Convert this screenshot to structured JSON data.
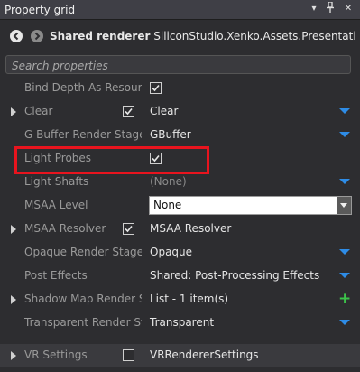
{
  "window": {
    "title": "Property grid",
    "controls": [
      "▾",
      "ᵖ",
      "✕"
    ]
  },
  "header": {
    "object_name": "Shared renderer",
    "object_type": "SiliconStudio.Xenko.Assets.Presentation.Ass..."
  },
  "search": {
    "placeholder": "Search properties",
    "value": ""
  },
  "properties": [
    {
      "name": "Bind Depth As Resourc...",
      "checkbox": true,
      "checked": true,
      "value": "",
      "expander": false
    },
    {
      "name": "Clear",
      "checkbox": true,
      "checked": true,
      "value": "Clear",
      "expander": true,
      "dropdown": true
    },
    {
      "name": "G Buffer Render Stage",
      "checkbox": false,
      "value": "GBuffer",
      "expander": false,
      "dropdown": true
    },
    {
      "name": "Light Probes",
      "checkbox": true,
      "checked": true,
      "value": "",
      "expander": false
    },
    {
      "name": "Light Shafts",
      "checkbox": false,
      "value": "(None)",
      "value_dim": true,
      "expander": false,
      "dropdown": true
    },
    {
      "name": "MSAA Level",
      "checkbox": false,
      "value": "None",
      "combo": true,
      "expander": false
    },
    {
      "name": "MSAA Resolver",
      "checkbox": true,
      "checked": true,
      "value": "MSAA Resolver",
      "expander": true
    },
    {
      "name": "Opaque Render Stage",
      "checkbox": false,
      "value": "Opaque",
      "expander": false,
      "dropdown": true
    },
    {
      "name": "Post Effects",
      "checkbox": false,
      "value": "Shared: Post-Processing Effects",
      "expander": false,
      "dropdown": true
    },
    {
      "name": "Shadow Map Render S...",
      "checkbox": false,
      "value": "List - 1 item(s)",
      "expander": true,
      "add": true
    },
    {
      "name": "Transparent Render St...",
      "checkbox": false,
      "value": "Transparent",
      "expander": false,
      "dropdown": true
    },
    {
      "name": "VR Settings",
      "checkbox": true,
      "checked": false,
      "value": "VRRendererSettings",
      "expander": true,
      "category": true
    }
  ],
  "colors": {
    "accent_blue": "#2e8ce6",
    "add_green": "#3cc24a",
    "highlight_red": "#e8141e"
  }
}
